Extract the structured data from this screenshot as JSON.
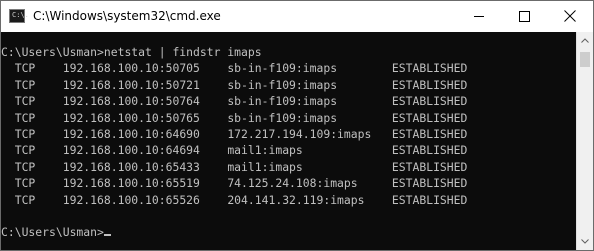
{
  "window": {
    "title": "C:\\Windows\\system32\\cmd.exe",
    "icon_text": "C:\\."
  },
  "icons": {
    "app": "cmd-icon",
    "minimize": "minimize-icon",
    "maximize": "maximize-icon",
    "close": "close-icon"
  },
  "console": {
    "command_line": "C:\\Users\\Usman>netstat | findstr imaps",
    "connections": [
      {
        "proto": "TCP",
        "local": "192.168.100.10:50705",
        "foreign": "sb-in-f109:imaps",
        "state": "ESTABLISHED"
      },
      {
        "proto": "TCP",
        "local": "192.168.100.10:50721",
        "foreign": "sb-in-f109:imaps",
        "state": "ESTABLISHED"
      },
      {
        "proto": "TCP",
        "local": "192.168.100.10:50764",
        "foreign": "sb-in-f109:imaps",
        "state": "ESTABLISHED"
      },
      {
        "proto": "TCP",
        "local": "192.168.100.10:50765",
        "foreign": "sb-in-f109:imaps",
        "state": "ESTABLISHED"
      },
      {
        "proto": "TCP",
        "local": "192.168.100.10:64690",
        "foreign": "172.217.194.109:imaps",
        "state": "ESTABLISHED"
      },
      {
        "proto": "TCP",
        "local": "192.168.100.10:64694",
        "foreign": "mail1:imaps",
        "state": "ESTABLISHED"
      },
      {
        "proto": "TCP",
        "local": "192.168.100.10:65433",
        "foreign": "mail1:imaps",
        "state": "ESTABLISHED"
      },
      {
        "proto": "TCP",
        "local": "192.168.100.10:65519",
        "foreign": "74.125.24.108:imaps",
        "state": "ESTABLISHED"
      },
      {
        "proto": "TCP",
        "local": "192.168.100.10:65526",
        "foreign": "204.141.32.119:imaps",
        "state": "ESTABLISHED"
      }
    ],
    "prompt": "C:\\Users\\Usman>"
  },
  "colors": {
    "console_bg": "#0c0c0c",
    "console_fg": "#c0c0c0"
  }
}
